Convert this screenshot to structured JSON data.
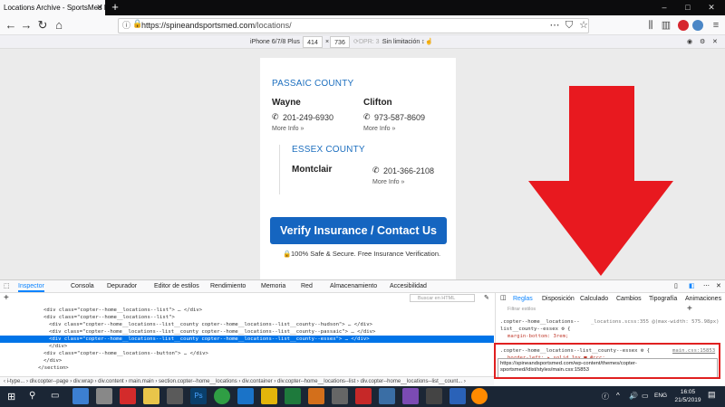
{
  "browser": {
    "tab_title": "Locations Archive - SportsMed Phy",
    "url_domain": "https://spineandsportsmed.com",
    "url_path": "/locations/",
    "window_controls": [
      "–",
      "□",
      "✕"
    ]
  },
  "rdm": {
    "device": "iPhone 6/7/8 Plus ↕",
    "width": "414",
    "height": "736",
    "dpr": "DPR: 3 ↕",
    "throttle": "Sin limitación ↕"
  },
  "page": {
    "passaic_county": "PASSAIC COUNTY",
    "wayne": {
      "city": "Wayne",
      "phone": "201-249-6930",
      "more": "More Info »"
    },
    "clifton": {
      "city": "Clifton",
      "phone": "973-587-8609",
      "more": "More Info »"
    },
    "essex_county": "ESSEX COUNTY",
    "montclair": {
      "city": "Montclair",
      "phone": "201-366-2108",
      "more": "More Info »"
    },
    "verify_button": "Verify Insurance / Contact Us",
    "secure_text": "100% Safe & Secure. Free Insurance Verification."
  },
  "devtools": {
    "tabs": [
      "Inspector",
      "Consola",
      "Depurador",
      "Editor de estilos",
      "Rendimiento",
      "Memoria",
      "Red",
      "Almacenamiento",
      "Accesibilidad"
    ],
    "search_placeholder": "Buscar en HTML",
    "right_tabs": [
      "Reglas",
      "Disposición",
      "Calculado",
      "Cambios",
      "Tipografía",
      "Animaciones"
    ],
    "filter_placeholder": "Filtrar estilos",
    "html_lines": [
      "<div class=\"copter--home__locations--list\"> … </div>",
      "<div class=\"copter--home__locations--list\">",
      "<div class=\"copter--home__locations--list__county copter--home__locations--list__county--hudson\"> … </div>",
      "<div class=\"copter--home__locations--list__county copter--home__locations--list__county--passaic\"> … </div>",
      "<div class=\"copter--home__locations--list__county copter--home__locations--list__county--essex\"> … </div>",
      "</div>",
      "<div class=\"copter--home__locations--button\"> … </div>",
      "</div>",
      "</section>"
    ],
    "rules": [
      ".copter--home__locations--",
      "list__county--essex ⚙ {",
      "_locations.scss:355 @(max-width: 575.98px)",
      "margin-bottom: 3rem;",
      ".copter--home__locations--list__county--essex ⚙ {",
      "main.css:15853",
      "border-left: ▸ solid 1px ■ #ccc;"
    ],
    "tooltip": "https://spineandsportsmed.com/wp-content/themes/copter-sportsmed//dist/styles/main.css:15853",
    "breadcrumbs": "‹ i-type... › div.copter--page › div.wrap › div.content › main.main › section.copter--home__locations › div.container › div.copter--home__locations--list › div.copter--home__locations--list__count... ›"
  },
  "taskbar": {
    "time": "16:05",
    "date": "21/5/2019",
    "lang": "ENG"
  },
  "colors": {
    "accent_blue": "#1565c0",
    "red_arrow": "#e8191f",
    "selection": "#0074e8"
  }
}
